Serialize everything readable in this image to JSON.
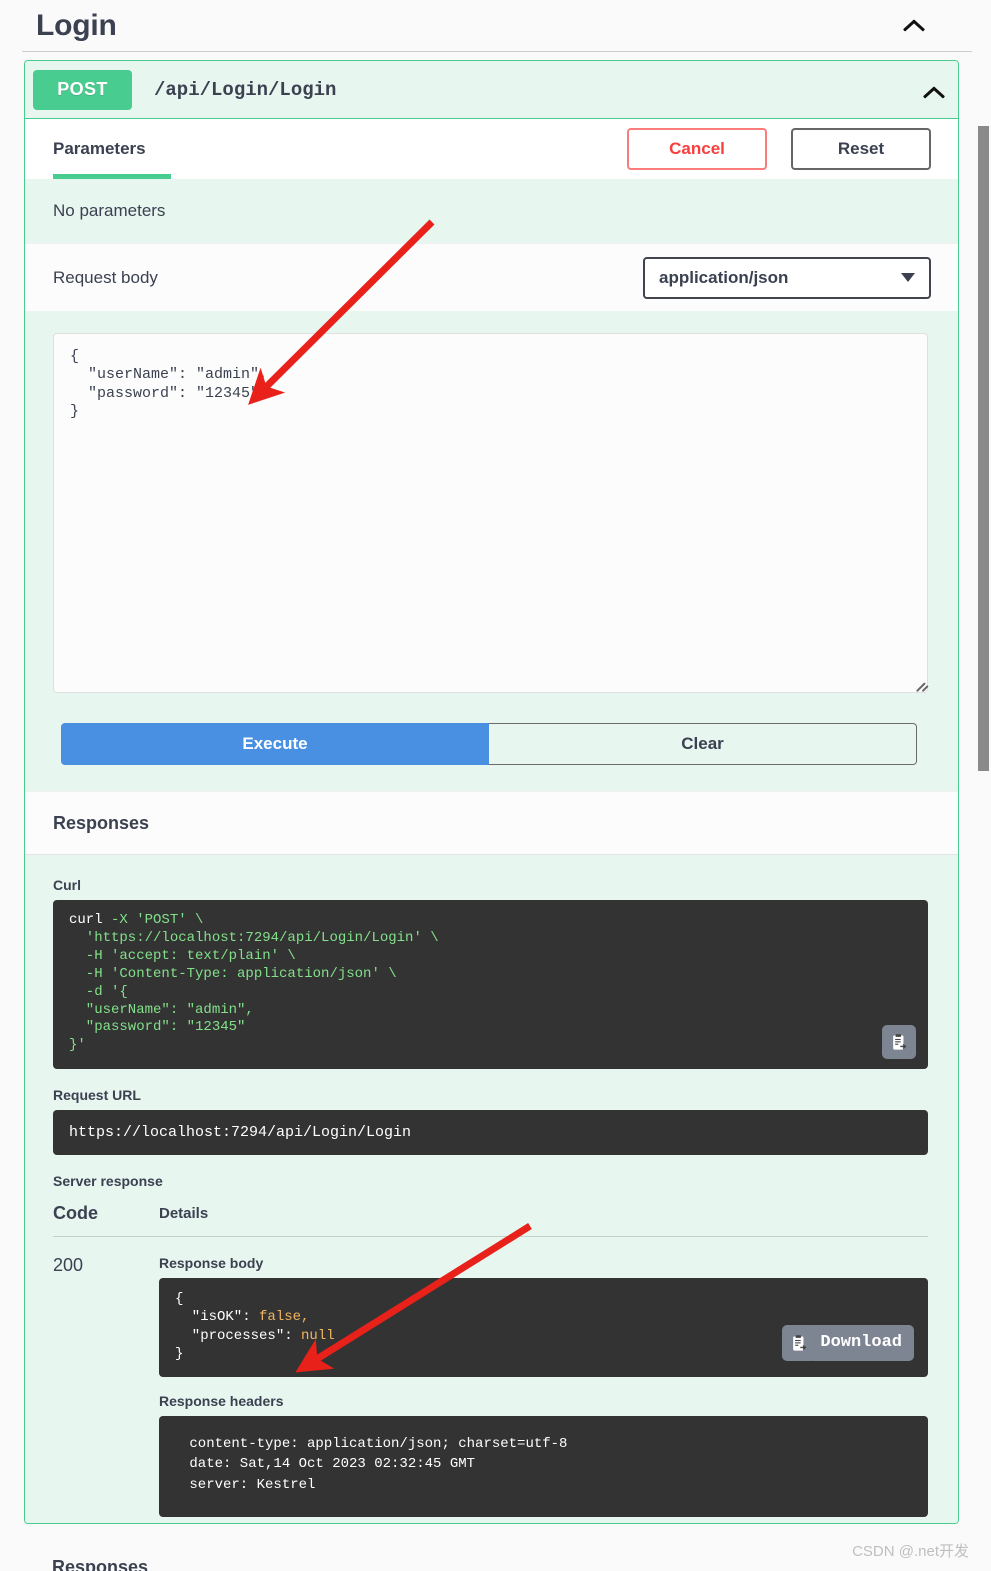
{
  "tag": {
    "title": "Login",
    "collapse_icon": "chevron-up-icon"
  },
  "operation": {
    "verb": "POST",
    "path": "/api/Login/Login",
    "collapse_icon": "chevron-up-icon"
  },
  "parameters_section": {
    "tab_label": "Parameters",
    "cancel_label": "Cancel",
    "reset_label": "Reset",
    "no_parameters_text": "No parameters",
    "request_body_label": "Request body",
    "media_type_selected": "application/json",
    "media_type_caret_icon": "chevron-down-icon",
    "request_body_value": "{\n  \"userName\": \"admin\",\n  \"password\": \"12345\"\n}"
  },
  "actions": {
    "execute_label": "Execute",
    "clear_label": "Clear"
  },
  "responses_section": {
    "heading": "Responses",
    "curl_label": "Curl",
    "curl_lines": [
      {
        "cmd": "curl",
        "rest": " -X 'POST' \\"
      },
      {
        "cmd": "",
        "rest": "  'https://localhost:7294/api/Login/Login' \\"
      },
      {
        "cmd": "",
        "rest": "  -H 'accept: text/plain' \\"
      },
      {
        "cmd": "",
        "rest": "  -H 'Content-Type: application/json' \\"
      },
      {
        "cmd": "",
        "rest": "  -d '{"
      },
      {
        "cmd": "",
        "rest": "  \"userName\": \"admin\","
      },
      {
        "cmd": "",
        "rest": "  \"password\": \"12345\""
      },
      {
        "cmd": "",
        "rest": "}'"
      }
    ],
    "curl_copy_icon": "copy-to-clipboard-icon",
    "request_url_label": "Request URL",
    "request_url_value": "https://localhost:7294/api/Login/Login",
    "server_response_label": "Server response",
    "table_headers": {
      "code": "Code",
      "details": "Details"
    },
    "response_code": "200",
    "response_body_label": "Response body",
    "response_body": {
      "open_brace": "{",
      "line1_key": "  \"isOK\": ",
      "line1_val": "false,",
      "line2_key": "  \"processes\": ",
      "line2_val": "null",
      "close_brace": "}"
    },
    "response_copy_icon": "copy-to-clipboard-icon",
    "download_label": "Download",
    "response_headers_label": "Response headers",
    "response_headers_value": " content-type: application/json; charset=utf-8 \n date: Sat,14 Oct 2023 02:32:45 GMT \n server: Kestrel ",
    "bottom_responses_heading": "Responses"
  },
  "watermark": "CSDN @.net开发",
  "colors": {
    "post_green": "#49cc90",
    "block_bg_green": "#e8f6f0",
    "execute_blue": "#4990e2",
    "cancel_red": "#f93e3e",
    "code_bg": "#333333",
    "code_green": "#82e08a",
    "code_orange": "#f3b562",
    "download_gray": "#7d8492",
    "arrow_red": "#e8211a"
  }
}
